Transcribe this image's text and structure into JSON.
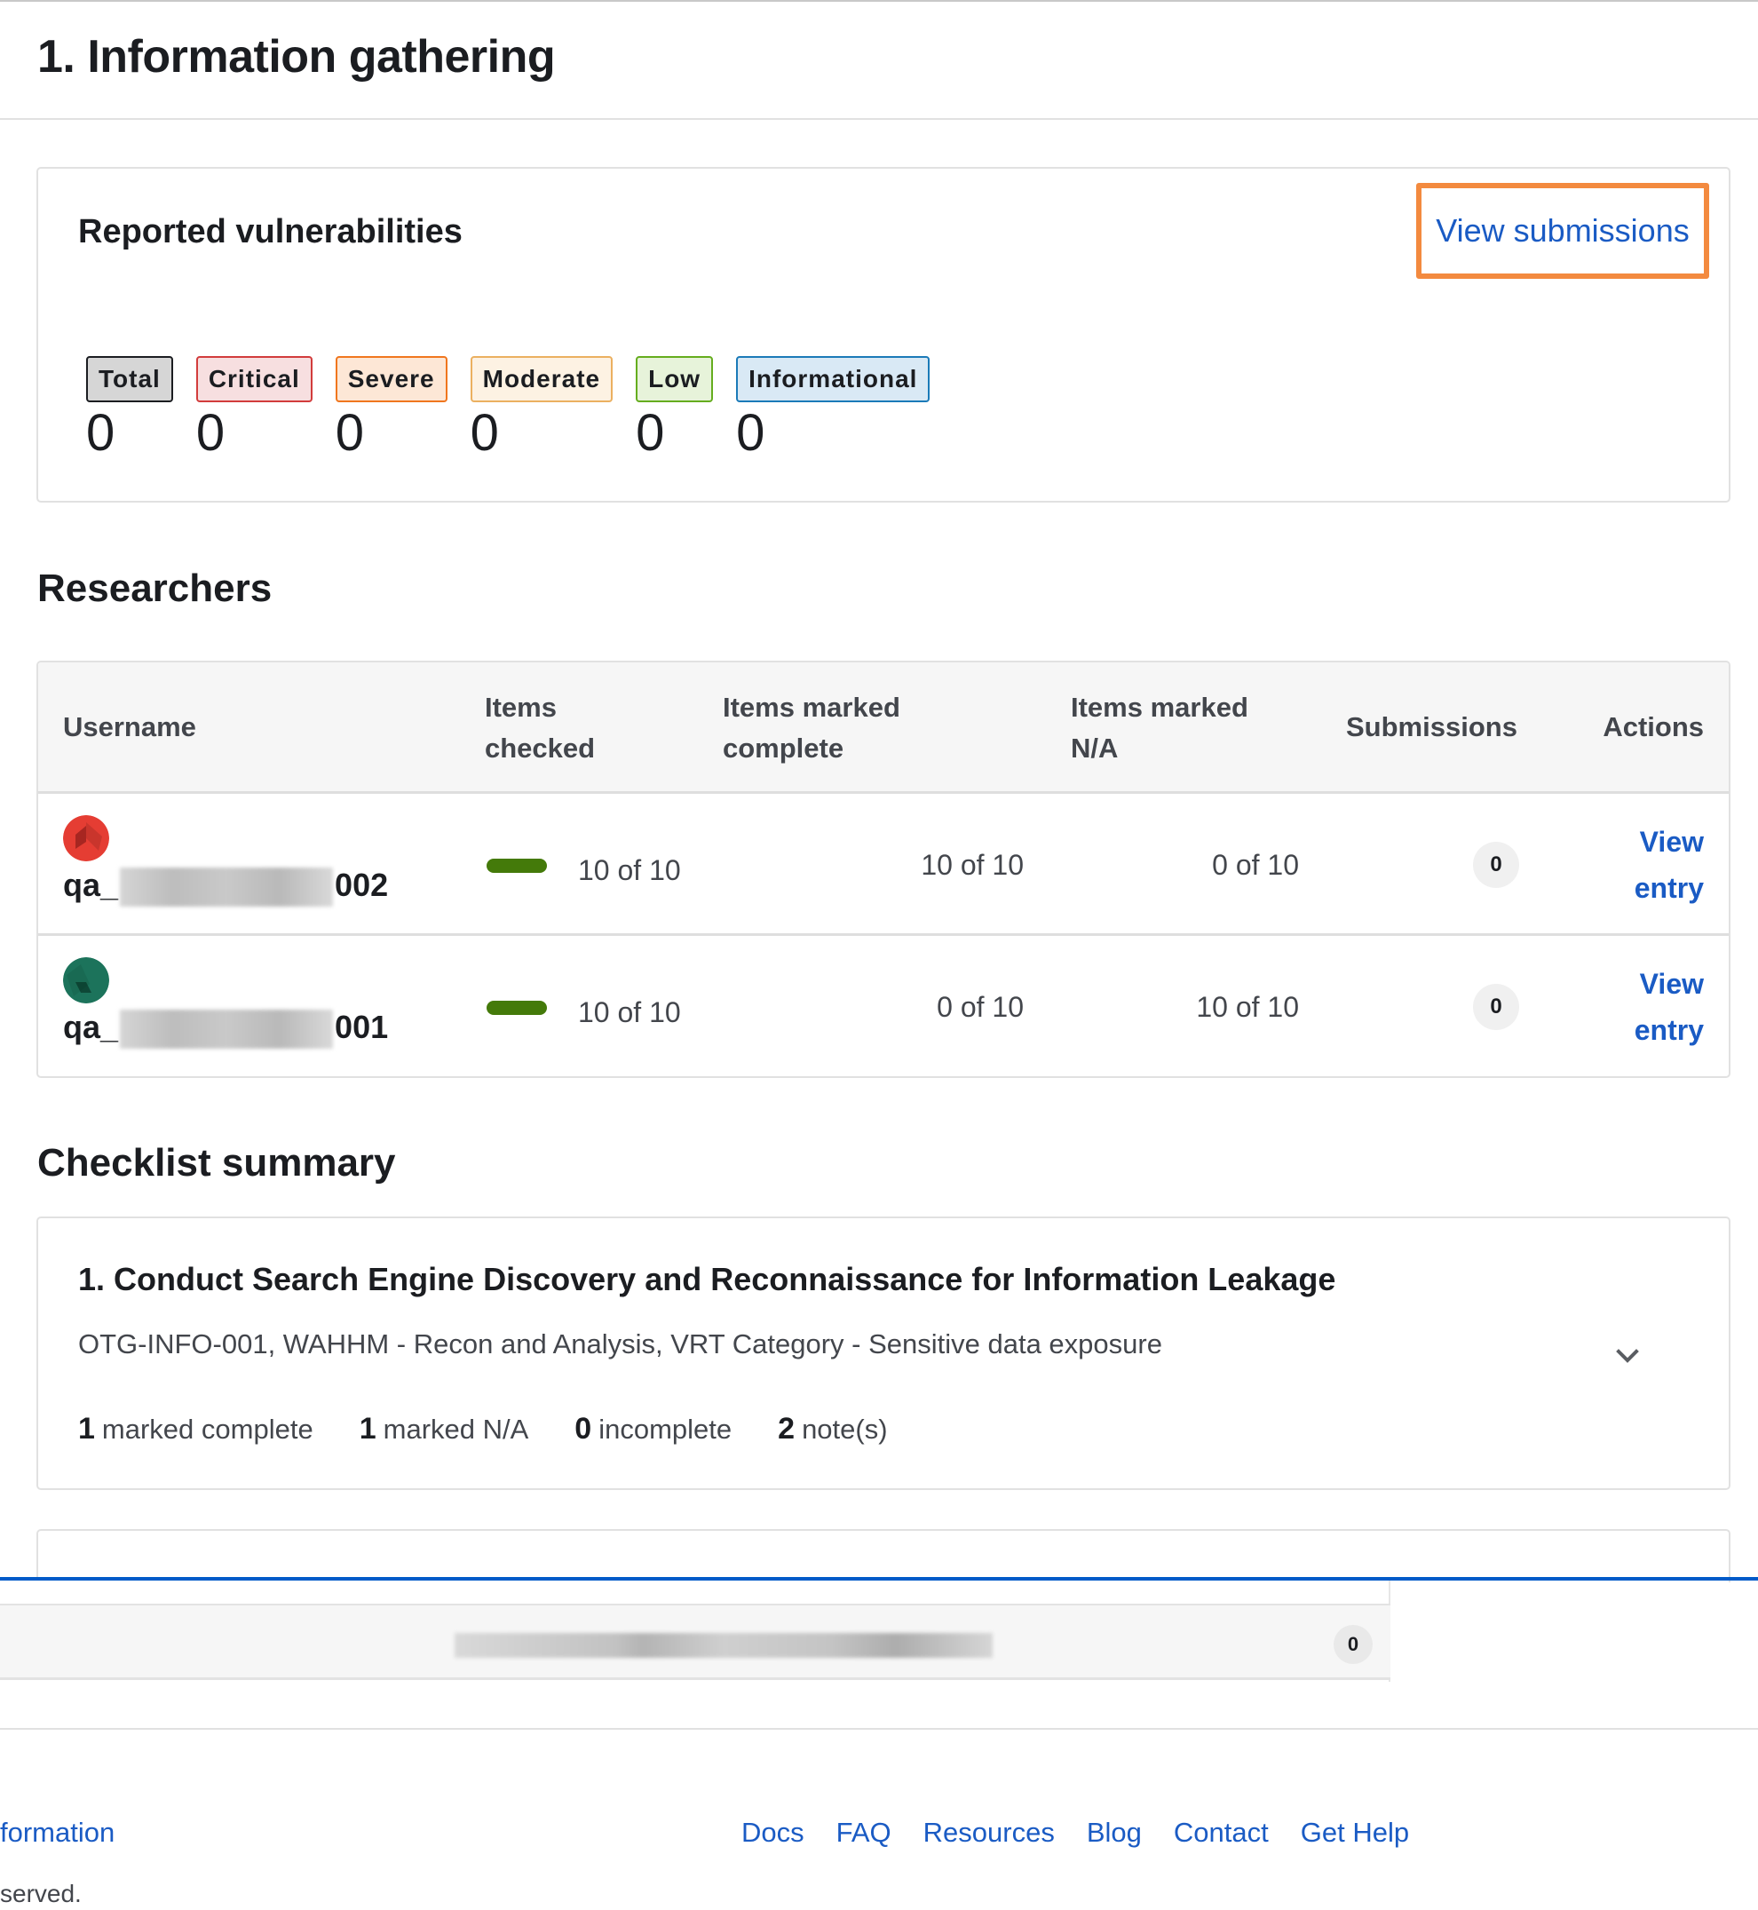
{
  "page": {
    "title": "1. Information gathering"
  },
  "vulnerabilities": {
    "title": "Reported vulnerabilities",
    "view_submissions_label": "View submissions",
    "badges": [
      {
        "label": "Total",
        "count": "0",
        "bg": "#d6d6d6",
        "border": "#1b1d21"
      },
      {
        "label": "Critical",
        "count": "0",
        "bg": "#f7dfe0",
        "border": "#d23c3c"
      },
      {
        "label": "Severe",
        "count": "0",
        "bg": "#fde7d6",
        "border": "#f0761e"
      },
      {
        "label": "Moderate",
        "count": "0",
        "bg": "#fdf2e3",
        "border": "#ebb060"
      },
      {
        "label": "Low",
        "count": "0",
        "bg": "#e7f3da",
        "border": "#65ad1e"
      },
      {
        "label": "Informational",
        "count": "0",
        "bg": "#d9e9f5",
        "border": "#1b7ab8"
      }
    ]
  },
  "researchers": {
    "title": "Researchers",
    "columns": {
      "username": "Username",
      "items_checked_1": "Items",
      "items_checked_2": "checked",
      "items_complete_1": "Items marked",
      "items_complete_2": "complete",
      "items_na_1": "Items marked",
      "items_na_2": "N/A",
      "submissions": "Submissions",
      "actions": "Actions"
    },
    "rows": [
      {
        "username_prefix": "qa_",
        "username_suffix": "002",
        "avatar_color": "#e53d33",
        "items_checked": "10 of 10",
        "items_checked_progress": 1.0,
        "items_complete": "10 of 10",
        "items_na": "0 of 10",
        "submissions": "0",
        "action_1": "View",
        "action_2": "entry"
      },
      {
        "username_prefix": "qa_",
        "username_suffix": "001",
        "avatar_color": "#1c735b",
        "items_checked": "10 of 10",
        "items_checked_progress": 1.0,
        "items_complete": "0 of 10",
        "items_na": "10 of 10",
        "submissions": "0",
        "action_1": "View",
        "action_2": "entry"
      }
    ]
  },
  "checklist": {
    "title": "Checklist summary",
    "items": [
      {
        "title": "1. Conduct Search Engine Discovery and Reconnaissance for Information Leakage",
        "subtitle": "OTG-INFO-001, WAHHM - Recon and Analysis, VRT Category - Sensitive data exposure",
        "stats": [
          {
            "count": "1",
            "label": "marked complete"
          },
          {
            "count": "1",
            "label": "marked N/A"
          },
          {
            "count": "0",
            "label": "incomplete"
          },
          {
            "count": "2",
            "label": "note(s)"
          }
        ]
      }
    ]
  },
  "overlay": {
    "bubble_count": "0"
  },
  "footer": {
    "left_link": "formation",
    "copyright": "served.",
    "links": [
      "Docs",
      "FAQ",
      "Resources",
      "Blog",
      "Contact",
      "Get Help"
    ]
  }
}
